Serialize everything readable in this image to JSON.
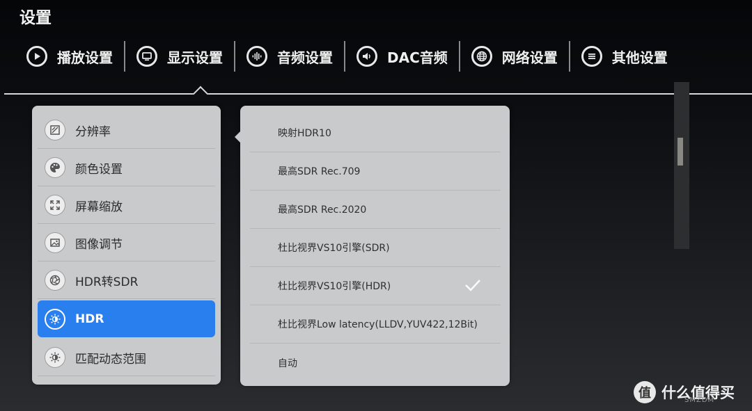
{
  "header": {
    "title": "设置"
  },
  "tabs": [
    {
      "label": "播放设置",
      "icon": "play-icon"
    },
    {
      "label": "显示设置",
      "icon": "monitor-icon"
    },
    {
      "label": "音频设置",
      "icon": "audio-wave-icon"
    },
    {
      "label": "DAC音频",
      "icon": "speaker-icon"
    },
    {
      "label": "网络设置",
      "icon": "globe-icon"
    },
    {
      "label": "其他设置",
      "icon": "menu-icon"
    }
  ],
  "active_tab": "显示设置",
  "left_menu": {
    "items": [
      {
        "label": "分辨率",
        "icon": "resolution-icon"
      },
      {
        "label": "颜色设置",
        "icon": "palette-icon"
      },
      {
        "label": "屏幕缩放",
        "icon": "expand-icon"
      },
      {
        "label": "图像调节",
        "icon": "image-icon"
      },
      {
        "label": "HDR转SDR",
        "icon": "aperture-icon"
      },
      {
        "label": "HDR",
        "icon": "sun-hdr-icon"
      },
      {
        "label": "匹配动态范围",
        "icon": "brightness-icon"
      }
    ],
    "selected": "HDR"
  },
  "options": {
    "items": [
      {
        "label": "映射HDR10"
      },
      {
        "label": "最高SDR Rec.709"
      },
      {
        "label": "最高SDR Rec.2020"
      },
      {
        "label": "杜比视界VS10引擎(SDR)"
      },
      {
        "label": "杜比视界VS10引擎(HDR)"
      },
      {
        "label": "杜比视界Low latency(LLDV,YUV422,12Bit)"
      },
      {
        "label": "自动"
      }
    ],
    "checked": "杜比视界VS10引擎(HDR)"
  },
  "watermark": {
    "logo": "值",
    "text": "什么值得买",
    "sub": "SMZDM"
  },
  "colors": {
    "accent": "#2a7fee",
    "panel": "#c9cacc",
    "background": "#0b0d10"
  }
}
